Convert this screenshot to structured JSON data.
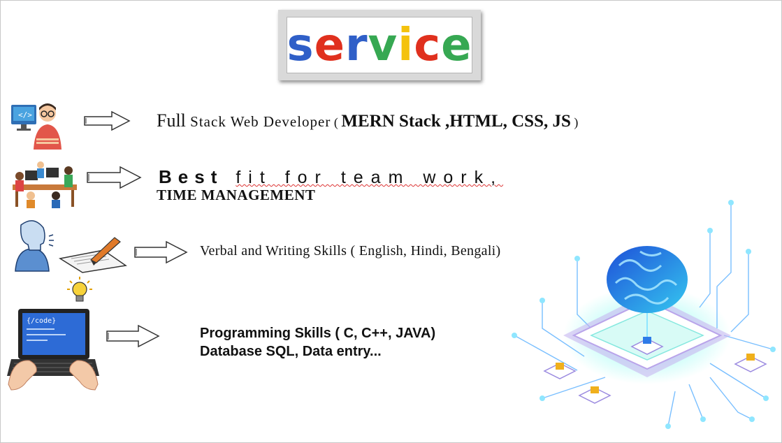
{
  "title": {
    "letters": [
      {
        "ch": "s",
        "color": "#2f5fc8"
      },
      {
        "ch": "e",
        "color": "#e0301e"
      },
      {
        "ch": "r",
        "color": "#2f5fc8"
      },
      {
        "ch": "v",
        "color": "#36a852"
      },
      {
        "ch": "i",
        "color": "#f4c20d"
      },
      {
        "ch": "c",
        "color": "#e0301e"
      },
      {
        "ch": "e",
        "color": "#36a852"
      }
    ]
  },
  "services": {
    "row1": {
      "full": "Full",
      "stack": " Stack Web Developer",
      "open": " ( ",
      "tech": "MERN Stack ,HTML, CSS, JS",
      "close": " )"
    },
    "row2": {
      "best": "Best",
      "rest": "fit for team work,",
      "line2": "TIME MANAGEMENT"
    },
    "row3": {
      "text": "Verbal and Writing Skills ( English, Hindi, Bengali)"
    },
    "row4": {
      "line1": "Programming Skills ( C, C++, JAVA)",
      "line2": "Database SQL, Data entry..."
    }
  },
  "icons": {
    "row1": "developer-at-monitor-icon",
    "row2": "team-at-desks-icon",
    "row3": "speaking-person-and-writing-pen-icon",
    "row4": "laptop-coding-with-lightbulb-icon",
    "decor": "ai-brain-circuit-illustration"
  }
}
